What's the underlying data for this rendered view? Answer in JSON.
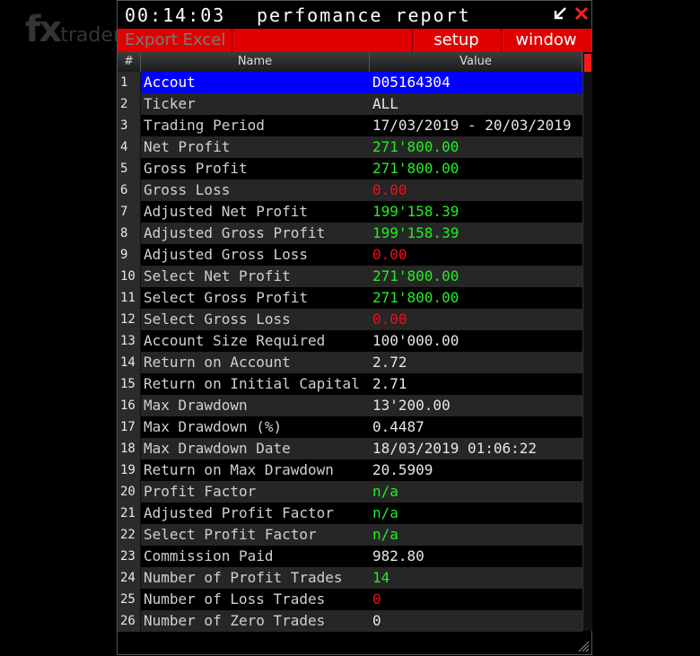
{
  "watermark": {
    "brand": "fx",
    "suffix": "trader"
  },
  "titlebar": {
    "clock": "00:14:03",
    "title": "perfomance report",
    "restore_icon": "arrow-down-left-icon",
    "close_icon": "close-icon"
  },
  "menu": {
    "export": "Export Excel",
    "setup": "setup",
    "window": "window"
  },
  "table": {
    "headers": [
      "#",
      "Name",
      "Value"
    ],
    "rows": [
      {
        "n": "1",
        "name": "Accout",
        "value": "D05164304",
        "color": "#ffffff"
      },
      {
        "n": "2",
        "name": "Ticker",
        "value": "ALL",
        "color": "#e6e6e6"
      },
      {
        "n": "3",
        "name": "Trading Period",
        "value": "17/03/2019 - 20/03/2019",
        "color": "#e6e6e6"
      },
      {
        "n": "4",
        "name": "Net Profit",
        "value": "271'800.00",
        "color": "#22ee22"
      },
      {
        "n": "5",
        "name": "Gross Profit",
        "value": "271'800.00",
        "color": "#22ee22"
      },
      {
        "n": "6",
        "name": "Gross Loss",
        "value": "0.00",
        "color": "#ee1111"
      },
      {
        "n": "7",
        "name": "Adjusted Net Profit",
        "value": "199'158.39",
        "color": "#22ee22"
      },
      {
        "n": "8",
        "name": "Adjusted Gross Profit",
        "value": "199'158.39",
        "color": "#22ee22"
      },
      {
        "n": "9",
        "name": "Adjusted Gross Loss",
        "value": "0.00",
        "color": "#ee1111"
      },
      {
        "n": "10",
        "name": "Select Net Profit",
        "value": "271'800.00",
        "color": "#22ee22"
      },
      {
        "n": "11",
        "name": "Select Gross Profit",
        "value": "271'800.00",
        "color": "#22ee22"
      },
      {
        "n": "12",
        "name": "Select Gross Loss",
        "value": "0.00",
        "color": "#ee1111"
      },
      {
        "n": "13",
        "name": "Account Size Required",
        "value": "100'000.00",
        "color": "#e6e6e6"
      },
      {
        "n": "14",
        "name": "Return on Account",
        "value": "2.72",
        "color": "#e6e6e6"
      },
      {
        "n": "15",
        "name": "Return on Initial Capital",
        "value": "2.71",
        "color": "#e6e6e6"
      },
      {
        "n": "16",
        "name": "Max Drawdown",
        "value": "13'200.00",
        "color": "#e6e6e6"
      },
      {
        "n": "17",
        "name": "Max Drawdown (%)",
        "value": "0.4487",
        "color": "#e6e6e6"
      },
      {
        "n": "18",
        "name": "Max Drawdown Date",
        "value": "18/03/2019 01:06:22",
        "color": "#e6e6e6"
      },
      {
        "n": "19",
        "name": "Return on Max Drawdown",
        "value": "20.5909",
        "color": "#e6e6e6"
      },
      {
        "n": "20",
        "name": "Profit Factor",
        "value": "n/a",
        "color": "#22ee22"
      },
      {
        "n": "21",
        "name": "Adjusted Profit Factor",
        "value": "n/a",
        "color": "#22ee22"
      },
      {
        "n": "22",
        "name": "Select Profit Factor",
        "value": "n/a",
        "color": "#22ee22"
      },
      {
        "n": "23",
        "name": "Commission Paid",
        "value": "982.80",
        "color": "#e6e6e6"
      },
      {
        "n": "24",
        "name": "Number of Profit Trades",
        "value": "14",
        "color": "#22ee22"
      },
      {
        "n": "25",
        "name": "Number of Loss Trades",
        "value": "0",
        "color": "#ee1111"
      },
      {
        "n": "26",
        "name": "Number of Zero Trades",
        "value": "0",
        "color": "#e6e6e6"
      }
    ]
  },
  "colors": {
    "accent": "#e00000",
    "selection": "#0000ff",
    "profit": "#22ee22",
    "loss": "#ee1111"
  }
}
